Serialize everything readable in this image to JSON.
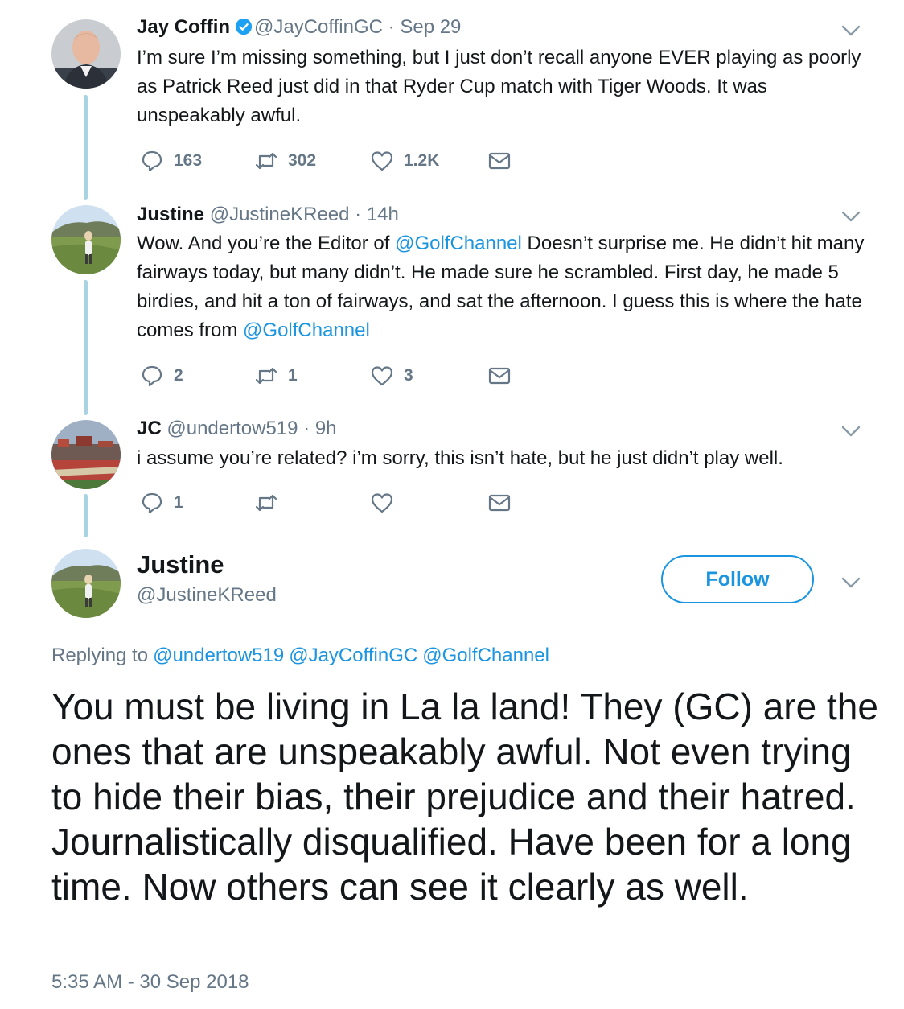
{
  "tweets": [
    {
      "name": "Jay Coffin",
      "verified": true,
      "handle": "@JayCoffinGC",
      "time": "· Sep 29",
      "text": "I’m sure I’m missing something, but I just don’t recall anyone EVER playing as poorly as Patrick Reed just did in that Ryder Cup match with Tiger Woods. It was unspeakably awful.",
      "replies": "163",
      "retweets": "302",
      "likes": "1.2K"
    },
    {
      "name": "Justine",
      "handle": "@JustineKReed",
      "time": "· 14h",
      "text_parts": [
        "Wow. And you’re the Editor of ",
        "@GolfChannel",
        " Doesn’t surprise me. He didn’t hit many fairways today, but many didn’t. He made sure he scrambled. First day, he made 5 birdies, and hit a ton of fairways, and sat the afternoon. I guess this is where the hate comes from ",
        "@GolfChannel"
      ],
      "replies": "2",
      "retweets": "1",
      "likes": "3"
    },
    {
      "name": "JC",
      "handle": "@undertow519",
      "time": "· 9h",
      "text": "i assume you’re related? i’m sorry, this isn’t hate, but he just didn’t play well.",
      "replies": "1",
      "retweets": "",
      "likes": ""
    }
  ],
  "main": {
    "name": "Justine",
    "handle": "@JustineKReed",
    "follow_label": "Follow",
    "replying_label": "Replying to",
    "replying_to": [
      "@undertow519",
      "@JayCoffinGC",
      "@GolfChannel"
    ],
    "text": "You must be living in La la land! They (GC) are the ones that are unspeakably awful.  Not even trying to hide their bias, their prejudice and their hatred.  Journalistically disqualified.  Have been for a long time.  Now others can see it clearly as well.",
    "timestamp": "5:35 AM - 30 Sep 2018"
  },
  "colors": {
    "link": "#1b95e0",
    "muted": "#657786",
    "thread": "#a8d3e2"
  },
  "icons": [
    "reply-icon",
    "retweet-icon",
    "like-icon",
    "message-icon",
    "chevron-down-icon",
    "verified-badge-icon"
  ]
}
